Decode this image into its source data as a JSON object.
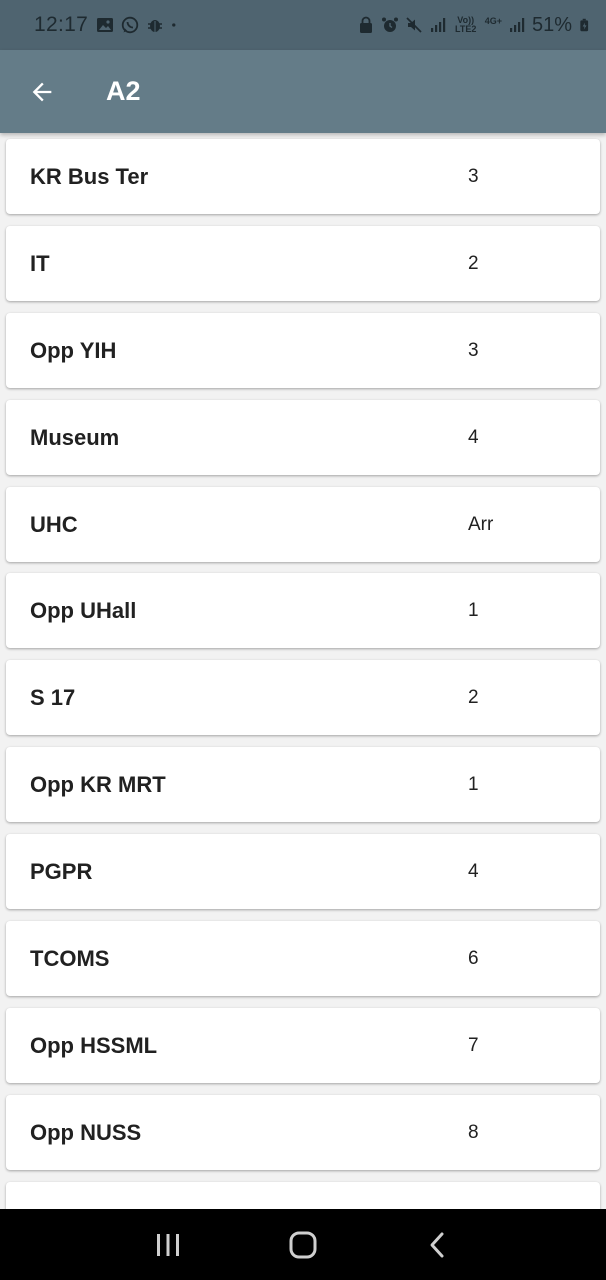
{
  "status_bar": {
    "time": "12:17",
    "battery_percent": "51%",
    "left_icons": [
      "gallery-icon",
      "whatsapp-icon",
      "bug-icon",
      "dot-icon"
    ],
    "right_icons": [
      "lock-icon",
      "alarm-icon",
      "mute-icon",
      "signal-icon",
      "volte-icon",
      "4g-icon",
      "signal-icon",
      "battery-icon"
    ],
    "volte_label": "Vo)) LTE2",
    "network_label": "4G+"
  },
  "app_bar": {
    "title": "A2",
    "background": "#647c88"
  },
  "stops": [
    {
      "name": "KR Bus Ter",
      "eta": "3"
    },
    {
      "name": "IT",
      "eta": "2"
    },
    {
      "name": "Opp YIH",
      "eta": "3"
    },
    {
      "name": "Museum",
      "eta": "4"
    },
    {
      "name": "UHC",
      "eta": "Arr"
    },
    {
      "name": "Opp UHall",
      "eta": "1"
    },
    {
      "name": "S 17",
      "eta": "2"
    },
    {
      "name": "Opp KR MRT",
      "eta": "1"
    },
    {
      "name": "PGPR",
      "eta": "4"
    },
    {
      "name": "TCOMS",
      "eta": "6"
    },
    {
      "name": "Opp HSSML",
      "eta": "7"
    },
    {
      "name": "Opp NUSS",
      "eta": "8"
    },
    {
      "name": "",
      "eta": ""
    }
  ],
  "nav_bar": {
    "buttons": [
      "recents-icon",
      "home-icon",
      "back-icon"
    ]
  }
}
